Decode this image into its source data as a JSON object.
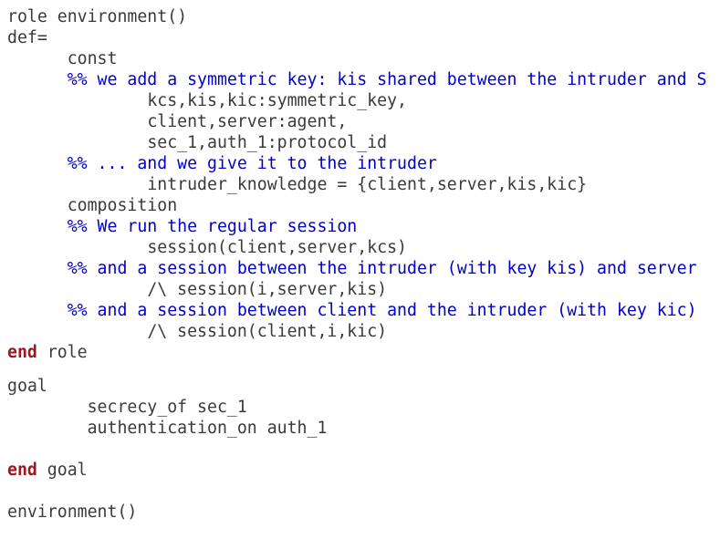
{
  "code": {
    "lines": [
      {
        "indent": "",
        "parts": [
          {
            "t": "role environment()",
            "k": "plain"
          }
        ]
      },
      {
        "indent": "",
        "parts": [
          {
            "t": "def=",
            "k": "plain"
          }
        ]
      },
      {
        "indent": "      ",
        "parts": [
          {
            "t": "const",
            "k": "plain"
          }
        ]
      },
      {
        "indent": "      ",
        "parts": [
          {
            "t": "%% we add a symmetric key: kis shared between the intruder and S",
            "k": "comment"
          }
        ]
      },
      {
        "indent": "              ",
        "parts": [
          {
            "t": "kcs,kis,kic:symmetric_key,",
            "k": "plain"
          }
        ]
      },
      {
        "indent": "              ",
        "parts": [
          {
            "t": "client,server:agent,",
            "k": "plain"
          }
        ]
      },
      {
        "indent": "              ",
        "parts": [
          {
            "t": "sec_1,auth_1:protocol_id",
            "k": "plain"
          }
        ]
      },
      {
        "indent": "      ",
        "parts": [
          {
            "t": "%% ... and we give it to the intruder",
            "k": "comment"
          }
        ]
      },
      {
        "indent": "              ",
        "parts": [
          {
            "t": "intruder_knowledge = {client,server,kis,kic}",
            "k": "plain"
          }
        ]
      },
      {
        "indent": "      ",
        "parts": [
          {
            "t": "composition",
            "k": "plain"
          }
        ]
      },
      {
        "indent": "      ",
        "parts": [
          {
            "t": "%% We run the regular session",
            "k": "comment"
          }
        ]
      },
      {
        "indent": "              ",
        "parts": [
          {
            "t": "session(client,server,kcs)",
            "k": "plain"
          }
        ]
      },
      {
        "indent": "      ",
        "parts": [
          {
            "t": "%% and a session between the intruder (with key kis) and server",
            "k": "comment"
          }
        ]
      },
      {
        "indent": "              ",
        "parts": [
          {
            "t": "/\\ session(i,server,kis)",
            "k": "plain"
          }
        ]
      },
      {
        "indent": "      ",
        "parts": [
          {
            "t": "%% and a session between client and the intruder (with key kic)",
            "k": "comment"
          }
        ]
      },
      {
        "indent": "              ",
        "parts": [
          {
            "t": "/\\ session(client,i,kic)",
            "k": "plain"
          }
        ]
      },
      {
        "indent": "",
        "parts": [
          {
            "t": "end",
            "k": "keyword"
          },
          {
            "t": " role",
            "k": "plain"
          }
        ]
      },
      {
        "indent": "",
        "parts": [
          {
            "t": "goal",
            "k": "plain"
          }
        ]
      },
      {
        "indent": "        ",
        "parts": [
          {
            "t": "secrecy_of sec_1",
            "k": "plain"
          }
        ]
      },
      {
        "indent": "        ",
        "parts": [
          {
            "t": "authentication_on auth_1",
            "k": "plain"
          }
        ]
      },
      {
        "indent": "",
        "parts": [
          {
            "t": "end",
            "k": "keyword"
          },
          {
            "t": " goal",
            "k": "plain"
          }
        ]
      },
      {
        "indent": "",
        "parts": [
          {
            "t": "environment()",
            "k": "plain"
          }
        ]
      }
    ]
  }
}
